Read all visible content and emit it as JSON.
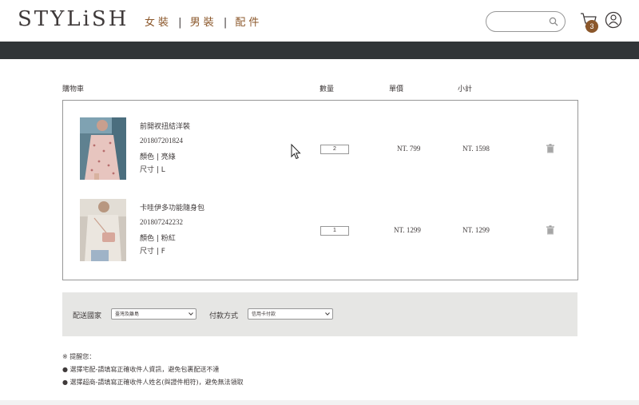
{
  "header": {
    "logo": "STYLiSH",
    "categories": [
      "女裝",
      "男裝",
      "配件"
    ],
    "search_placeholder": "",
    "cart_count": "3"
  },
  "cart": {
    "title": "購物車",
    "columns": {
      "qty": "數量",
      "price": "單價",
      "subtotal": "小計"
    },
    "items": [
      {
        "name": "前開衩扭結洋裝",
        "id": "201807201824",
        "color": "顏色 | 亮綠",
        "size": "尺寸 | L",
        "qty": "2",
        "price": "NT. 799",
        "subtotal": "NT. 1598"
      },
      {
        "name": "卡哇伊多功能隨身包",
        "id": "201807242232",
        "color": "顏色 | 粉紅",
        "size": "尺寸 | F",
        "qty": "1",
        "price": "NT. 1299",
        "subtotal": "NT. 1299"
      }
    ]
  },
  "checkout": {
    "country_label": "配送國家",
    "country_value": "臺灣及離島",
    "payment_label": "付款方式",
    "payment_value": "信用卡付款"
  },
  "notes": {
    "title": "※ 提醒您：",
    "lines": [
      "● 選擇宅配-請填寫正確收件人資訊，避免包裹配送不達",
      "● 選擇超商-請填寫正確收件人姓名(與證件相符)，避免無法領取"
    ]
  },
  "colors": {
    "accent": "#8b572a",
    "dark_band": "#313538",
    "panel": "#e6e6e4"
  }
}
